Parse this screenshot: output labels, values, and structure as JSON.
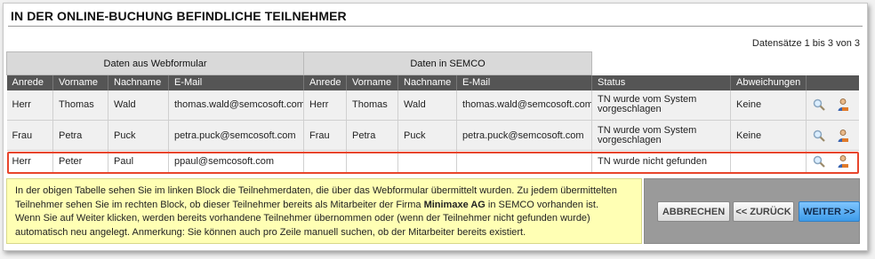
{
  "title": "IN DER ONLINE-BUCHUNG BEFINDLICHE TEILNEHMER",
  "records_info": "Datensätze 1 bis 3 von 3",
  "groups": {
    "webform": "Daten aus Webformular",
    "semco": "Daten in SEMCO"
  },
  "columns": [
    "Anrede",
    "Vorname",
    "Nachname",
    "E-Mail",
    "Anrede",
    "Vorname",
    "Nachname",
    "E-Mail",
    "Status",
    "Abweichungen"
  ],
  "rows": [
    {
      "web": {
        "anrede": "Herr",
        "vorname": "Thomas",
        "nachname": "Wald",
        "email": "thomas.wald@semcosoft.com"
      },
      "semco": {
        "anrede": "Herr",
        "vorname": "Thomas",
        "nachname": "Wald",
        "email": "thomas.wald@semcosoft.com"
      },
      "status": "TN wurde vom System vorgeschlagen",
      "abweichungen": "Keine"
    },
    {
      "web": {
        "anrede": "Frau",
        "vorname": "Petra",
        "nachname": "Puck",
        "email": "petra.puck@semcosoft.com"
      },
      "semco": {
        "anrede": "Frau",
        "vorname": "Petra",
        "nachname": "Puck",
        "email": "petra.puck@semcosoft.com"
      },
      "status": "TN wurde vom System vorgeschlagen",
      "abweichungen": "Keine"
    },
    {
      "web": {
        "anrede": "Herr",
        "vorname": "Peter",
        "nachname": "Paul",
        "email": "ppaul@semcosoft.com"
      },
      "semco": {
        "anrede": "",
        "vorname": "",
        "nachname": "",
        "email": ""
      },
      "status": "TN wurde nicht gefunden",
      "abweichungen": ""
    }
  ],
  "row_icons": [
    "magnifier-icon",
    "user-icon"
  ],
  "info_text": {
    "line1": "In der obigen Tabelle sehen Sie im linken Block die Teilnehmerdaten, die über das Webformular übermittelt wurden. Zu jedem übermittelten",
    "line2_pre": "Teilnehmer sehen Sie im rechten Block, ob dieser Teilnehmer bereits als Mitarbeiter der Firma ",
    "line2_company": "Minimaxe AG",
    "line2_post": " in SEMCO vorhanden ist.",
    "line3": "Wenn Sie auf Weiter klicken, werden bereits vorhandene Teilnehmer übernommen oder (wenn der Teilnehmer nicht gefunden wurde)",
    "line4": "automatisch neu angelegt. Anmerkung: Sie können auch pro Zeile manuell suchen, ob der Mitarbeiter bereits existiert."
  },
  "buttons": {
    "cancel": "ABBRECHEN",
    "back": "<< ZURÜCK",
    "next": "WEITER >>"
  },
  "colors": {
    "header_bg": "#555555",
    "group_bg": "#d9d9d9",
    "highlight": "#e8452c",
    "note_bg": "#ffffb4",
    "primary_button": "#3d9be9"
  }
}
